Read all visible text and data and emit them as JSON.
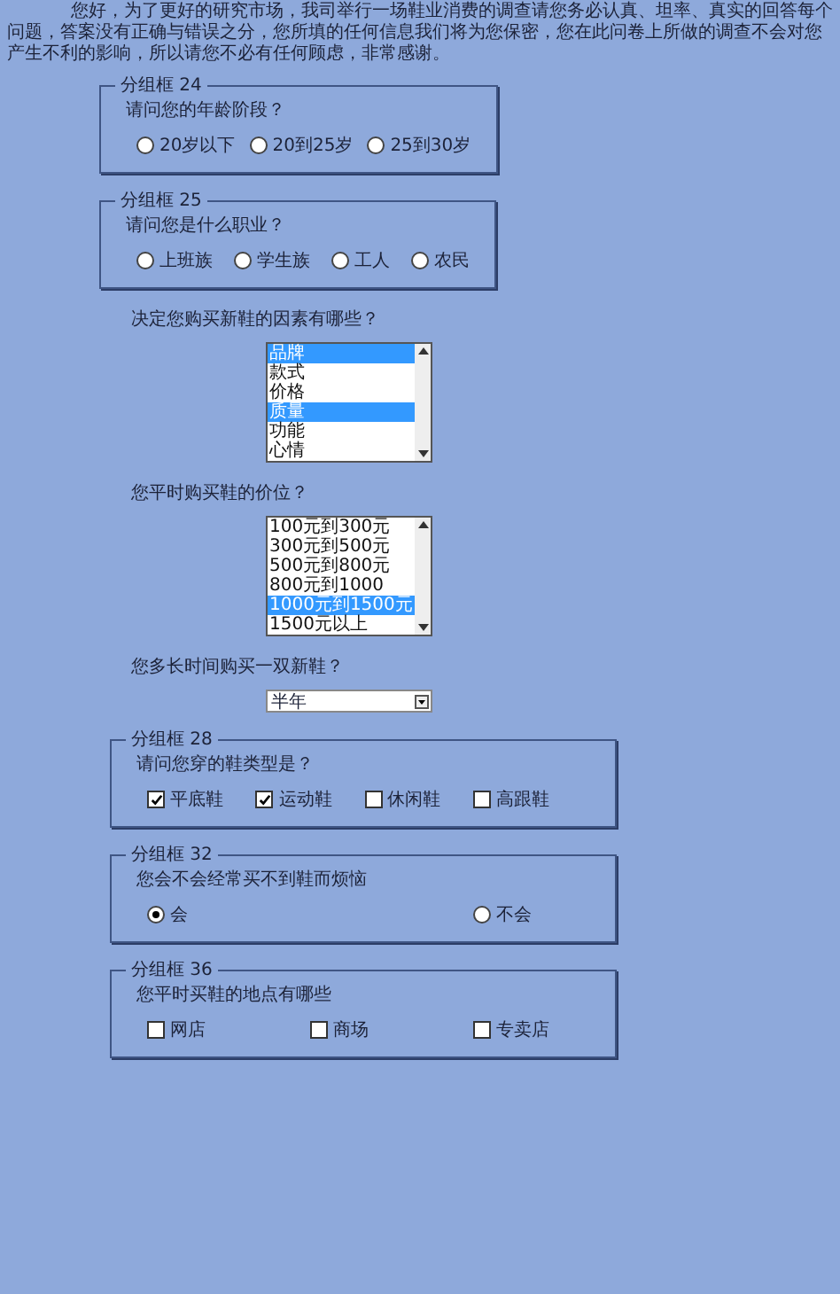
{
  "intro": "您好，为了更好的研究市场，我司举行一场鞋业消费的调查请您务必认真、坦率、真实的回答每个问题，答案没有正确与错误之分，您所填的任何信息我们将为您保密，您在此问卷上所做的调查不会对您产生不利的影响，所以请您不必有任何顾虑，非常感谢。",
  "sections": [
    {
      "kind": "narrow_group",
      "legend": "分组框 24",
      "question": "请问您的年龄阶段？",
      "options": [
        {
          "kind": "radio",
          "label": "20岁以下",
          "selected": false
        },
        {
          "kind": "radio",
          "label": "20到25岁",
          "selected": false
        },
        {
          "kind": "radio",
          "label": "25到30岁",
          "selected": false
        }
      ]
    },
    {
      "kind": "narrow_group",
      "legend": "分组框 25",
      "question": "请问您是什么职业？",
      "options": [
        {
          "kind": "radio",
          "label": "上班族",
          "selected": false
        },
        {
          "kind": "radio",
          "label": "学生族",
          "selected": false
        },
        {
          "kind": "radio",
          "label": "工人",
          "selected": false
        },
        {
          "kind": "radio",
          "label": "农民",
          "selected": false
        }
      ]
    },
    {
      "kind": "listbox",
      "question": "决定您购买新鞋的因素有哪些？",
      "items": [
        {
          "label": "品牌",
          "selected": true
        },
        {
          "label": "款式",
          "selected": false
        },
        {
          "label": "价格",
          "selected": false
        },
        {
          "label": "质量",
          "selected": true
        },
        {
          "label": "功能",
          "selected": false
        },
        {
          "label": "心情",
          "selected": false
        }
      ]
    },
    {
      "kind": "listbox",
      "question": "您平时购买鞋的价位？",
      "items": [
        {
          "label": "100元到300元",
          "selected": false
        },
        {
          "label": "300元到500元",
          "selected": false
        },
        {
          "label": "500元到800元",
          "selected": false
        },
        {
          "label": "800元到1000",
          "selected": false
        },
        {
          "label": "1000元到1500元",
          "selected": true
        },
        {
          "label": "1500元以上",
          "selected": false
        }
      ]
    },
    {
      "kind": "dropdown",
      "question": "您多长时间购买一双新鞋？",
      "value": "半年"
    },
    {
      "kind": "wide_group",
      "legend": "分组框 28",
      "question": "请问您穿的鞋类型是？",
      "options": [
        {
          "kind": "checkbox",
          "label": "平底鞋",
          "checked": true
        },
        {
          "kind": "checkbox",
          "label": "运动鞋",
          "checked": true
        },
        {
          "kind": "checkbox",
          "label": "休闲鞋",
          "checked": false
        },
        {
          "kind": "checkbox",
          "label": "高跟鞋",
          "checked": false
        }
      ]
    },
    {
      "kind": "wide_group",
      "legend": "分组框 32",
      "question": "您会不会经常买不到鞋而烦恼",
      "options": [
        {
          "kind": "radio",
          "label": "会",
          "selected": true
        },
        {
          "kind": "radio",
          "label": "不会",
          "selected": false
        }
      ]
    },
    {
      "kind": "wide_group",
      "legend": "分组框 36",
      "question": "您平时买鞋的地点有哪些",
      "options": [
        {
          "kind": "checkbox",
          "label": "网店",
          "checked": false
        },
        {
          "kind": "checkbox",
          "label": "商场",
          "checked": false
        },
        {
          "kind": "checkbox",
          "label": "专卖店",
          "checked": false
        }
      ]
    }
  ]
}
